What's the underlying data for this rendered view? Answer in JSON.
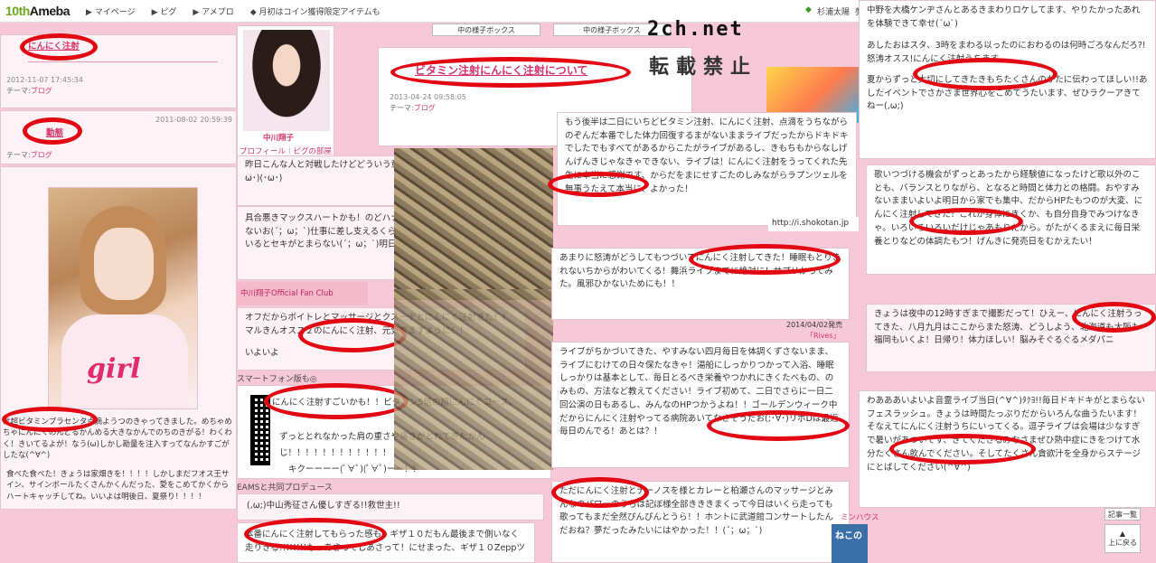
{
  "topbar": {
    "logo_prefix": "10th",
    "logo_main": "Ameba",
    "nav": [
      "▶ マイページ",
      "▶ ピグ",
      "▶ アメプロ",
      "◆ 月初はコイン獲得限定アイテムも"
    ],
    "right": [
      "杉浦太陽",
      "夢の"
    ]
  },
  "watermark": {
    "line1": "2ch.net",
    "line2": "転載禁止"
  },
  "left": {
    "post1_title": "にんにく注射",
    "post1_date": "2012-11-07 17:45:34",
    "post1_theme_prefix": "テーマ:",
    "post1_theme": "ブログ",
    "post2_date": "2011-08-02 20:59:39",
    "post2_title": "勤態",
    "post2_theme_prefix": "テーマ:",
    "post2_theme": "ブログ",
    "shirt_text": "girl",
    "caption": "は超ビタミンブラセンタ点滴ようつのきゃってきました。めちゃめちゃにんにくのんどるかんめる大きなかんでのちのきがる！わくわく！きいてるよが！なう(ω)しかし勘量を注入すってなんかすごがしたな(^∀^)",
    "tail": "食べた食べた！きょうは家畑きを！！！！しかしまだフオス王サイン、サインボールたくさんかくんだった、愛をこめてかくからハートキャッチしてね。いいよは明後日、夏祭り！！！！"
  },
  "profile": {
    "name": "中川翔子",
    "links": "プロフィール｜ピグの部屋",
    "club_label": "中川翔子Official Fan Club",
    "sp_label": "スマートフォン版も◎",
    "bottom_label": "EAMSと共同プロデュース"
  },
  "mid": {
    "box1": "昨日こんな人と対戦したけどどういう意図でこの名前にしたんだろうか？(･ω･)(･ω･)",
    "box2": "具合悪きマックスハートかも！のどハナもくみめまい一一全然クスリ効かないお(´；ω；`)仕事に差し支えるくらい、くしゃみ鼻水、乾燥したとこにいるとセキがとまらない(´；ω；`)明日にんにく注射やるお(´；ω；`)",
    "box3": "オフだからボイトレとマッサージとクスーテとにんにく注射きた！！マルきんオスス２のにんにく注射、元気でますように！！",
    "box3b": "いよいよ",
    "box4": "にんにく注射すごいかも！！ビタミン5倍の超にんにくコース、",
    "box4b": "ずっととれなかった肩の重さや痛さがとれてきたかん",
    "box4c": "じ！！！！！！！！！！！！",
    "box4d": "キクーーーー(ﾟ∀ﾟ)(ﾟ∀ﾟ)ーー！！",
    "box5": "(,ω;)中山秀征さん優しすぎる!!救世主!!",
    "box6": "本番にんにく注射してもらった感も。ギザ１０だもん最後まで側いなく走りきる!!!!!!!!もっあさってしあさって！にせまった、ギザ１０Zeppツ"
  },
  "center": {
    "title": "ビタミン注射にんにく注射について",
    "date": "2013-04-24 09:58:05",
    "theme_prefix": "テーマ:",
    "theme": "ブログ",
    "tabs": [
      "中の様子ボックス",
      "中の様子ボックス"
    ]
  },
  "right1": {
    "box1": "もう後半は二日にいちどビタミン注射、にんにく注射、点滴をうちながらのぞんだ本番でした体力回復するまがないままライブだったからドキドキでしたでもすべてがあるからこたがライブがあるし、きもちもからなしげんげんきじゃなきゃできない、ライブは！にんにく注射をうってくれた先生に本当に感謝です、からだをまにせすごたのしみながらラプンツェルを無事うたえて本当に、よかった！",
    "box2": "あまりに怒涛がどうしてもつづいてにんにく注射してきた！睡眠もとりきれないちからがわいてくる！舞浜ライブまでに絶対に！サプリかってみた。風邪ひかないためにも！！",
    "release": "2014/04/02発売",
    "release_title": "「Rives」",
    "box3": "ライブがちかづいてきた、やすみない四月毎日を体調くずさないまま、ライブにむけての日々保たなきゃ！湯船にしっかりつかって入浴、睡眠しっかりは基本として、毎日とるべき栄養やつかれにきくたべもの、のみもの、方法など教えてください！ライブ初めて、二日でさらに一日二回公演の日もあるし、みんなのHPつかうよね！！ゴールデンウィーク中だからにんにく注射やってる病院あいてなさそうだお(;･∀･)リボDは最近毎日のんでる！あとは？！",
    "box4": "ただにんにく注射とナーノスを様とカレーと柏瀬さんのマッサージとみんなのパワーのうちは記ぼ様全部きききまくって今日はいくら走っても歌ってもまだ全然ぴんぴんとうら！！ホントに武道館コンサートしたんだおね？夢だったみたいにはやかった！！(´；ω；`)",
    "url": "http://i.shokotan.jp",
    "house_label": "ミンハウス"
  },
  "right2": {
    "box1": "中野を大橋ケンヂさんとあるきまわりロケしてます、やりたかったあれを体験できて幸せ(´ω`)",
    "box2": "あしたおはスタ、3時をまわる以ったのにおわるのは何時ごろなんだろ?!怒涛オスス!にんにく注射うちます。。",
    "box3": "夏からずっと大切にしてきたきもちたくさんのかたに伝わってほしい!!あしたイベントでさかさま世界心をこめてうたいます、ぜひラクーアきてねー(,ω;)",
    "box4": "歌いつづける機会がずっとあったから経験値になったけど歌以外のことも、バランスとりながら、となると時間と体力との格闘。おやすみないままいよいよ明日から家でも集中、だからHPたもつのが大変、にんにく注射してきた！これが身体にきくか、も自分自身でみつけなきゃ。いろいろいろいだけじゃあもりだから。がたがくるまえに毎日栄養とりなどの体調たもつ！げんきに発売日をむかえたい！",
    "box5": "きょうは夜中の12時すぎまで撮影だって！ひえー、にんにく注射うってきた、八月九月はここからまた怒涛、どうしよう、北海道も大阪も福岡もいくよ！日帰り！体力ほしい！脳みそぐるぐるメダパニ",
    "box6": "わあああいよいよ音霊ライブ当日(^∀^)ﾀｸﾖ!!毎日ドキドキがとまらないフェスラッシュ。きょうは時間たっぷりだからいろんな曲うたいます！そなえてにんにく注射うちにいってくる。逗子ライブは会場は少なすぎで暑いがあついです、きてくださるみなさまぜひ熱中症にきをつけて水分たくさん飲んでください。そしてたくさん貪欲汁を全身からステージにとばしてください(^∀^)"
  },
  "controls": {
    "list_btn": "記事一覧",
    "top_btn": "上に戻る",
    "bottom_card": "ねこの"
  }
}
